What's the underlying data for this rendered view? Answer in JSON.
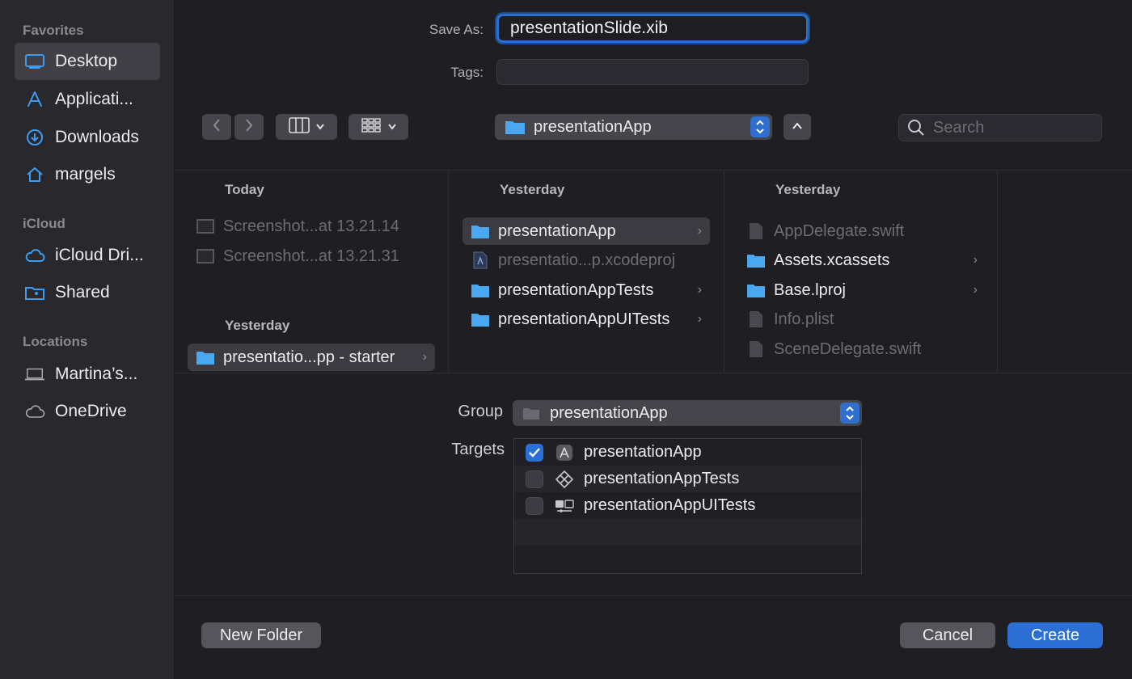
{
  "sidebar": {
    "favorites_header": "Favorites",
    "favorites": [
      {
        "label": "Desktop",
        "icon": "desktop-icon",
        "active": true
      },
      {
        "label": "Applicati...",
        "icon": "applications-icon"
      },
      {
        "label": "Downloads",
        "icon": "downloads-icon"
      },
      {
        "label": "margels",
        "icon": "home-icon"
      }
    ],
    "icloud_header": "iCloud",
    "icloud": [
      {
        "label": "iCloud Dri...",
        "icon": "cloud-icon"
      },
      {
        "label": "Shared",
        "icon": "shared-folder-icon"
      }
    ],
    "locations_header": "Locations",
    "locations": [
      {
        "label": "Martina’s...",
        "icon": "laptop-icon"
      },
      {
        "label": "OneDrive",
        "icon": "cloud-icon"
      }
    ]
  },
  "form": {
    "save_as_label": "Save As:",
    "save_as_value": "presentationSlide.xib",
    "tags_label": "Tags:",
    "tags_value": ""
  },
  "toolbar": {
    "back_icon": "chevron-left-icon",
    "forward_icon": "chevron-right-icon",
    "view_icon": "columns-view-icon",
    "group_icon": "grid-view-icon",
    "location": "presentationApp",
    "search_placeholder": "Search"
  },
  "browser": {
    "columns": [
      {
        "groups": [
          {
            "header": "Today",
            "rows": [
              {
                "label": "Screenshot...at 13.21.14",
                "icon": "screenshot-icon",
                "dim": true
              },
              {
                "label": "Screenshot...at 13.21.31",
                "icon": "screenshot-icon",
                "dim": true
              }
            ]
          },
          {
            "header": "Yesterday",
            "rows": [
              {
                "label": "presentatio...pp - starter",
                "icon": "folder-icon",
                "selected": true,
                "chevron": true
              }
            ]
          }
        ]
      },
      {
        "groups": [
          {
            "header": "Yesterday",
            "rows": [
              {
                "label": "presentationApp",
                "icon": "folder-icon",
                "selected": true,
                "chevron": true
              },
              {
                "label": "presentatio...p.xcodeproj",
                "icon": "xcodeproj-icon",
                "dim": true
              },
              {
                "label": "presentationAppTests",
                "icon": "folder-icon",
                "chevron": true
              },
              {
                "label": "presentationAppUITests",
                "icon": "folder-icon",
                "chevron": true
              }
            ]
          }
        ]
      },
      {
        "groups": [
          {
            "header": "Yesterday",
            "rows": [
              {
                "label": "AppDelegate.swift",
                "icon": "file-icon",
                "dim": true
              },
              {
                "label": "Assets.xcassets",
                "icon": "folder-icon",
                "chevron": true
              },
              {
                "label": "Base.lproj",
                "icon": "folder-icon",
                "chevron": true
              },
              {
                "label": "Info.plist",
                "icon": "file-icon",
                "dim": true
              },
              {
                "label": "SceneDelegate.swift",
                "icon": "file-icon",
                "dim": true
              }
            ]
          }
        ]
      }
    ]
  },
  "options": {
    "group_label": "Group",
    "group_value": "presentationApp",
    "targets_label": "Targets",
    "targets": [
      {
        "label": "presentationApp",
        "checked": true,
        "icon": "app-target-icon"
      },
      {
        "label": "presentationAppTests",
        "checked": false,
        "icon": "test-target-icon"
      },
      {
        "label": "presentationAppUITests",
        "checked": false,
        "icon": "ui-test-target-icon"
      }
    ]
  },
  "buttons": {
    "new_folder": "New Folder",
    "cancel": "Cancel",
    "create": "Create"
  },
  "colors": {
    "accent": "#2b6ed4",
    "folder": "#4aa8f0"
  }
}
